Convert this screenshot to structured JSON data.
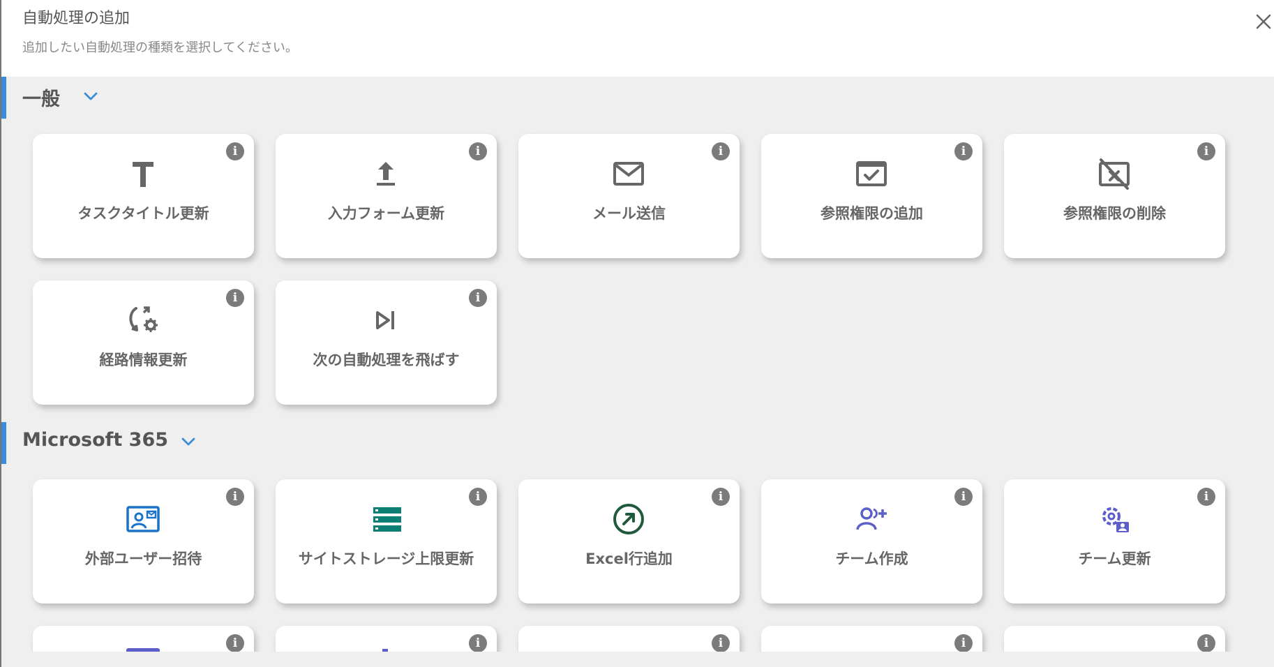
{
  "dialog": {
    "title": "自動処理の追加",
    "subtitle": "追加したい自動処理の種類を選択してください。",
    "close_icon": "close-icon"
  },
  "sections": [
    {
      "title": "一般",
      "chevron_icon": "chevron-down-icon",
      "cards": [
        {
          "label": "タスクタイトル更新",
          "icon": "text-t-icon"
        },
        {
          "label": "入力フォーム更新",
          "icon": "upload-arrow-icon"
        },
        {
          "label": "メール送信",
          "icon": "mail-icon"
        },
        {
          "label": "参照権限の追加",
          "icon": "window-check-icon"
        },
        {
          "label": "参照権限の削除",
          "icon": "window-remove-icon"
        },
        {
          "label": "経路情報更新",
          "icon": "route-settings-icon"
        },
        {
          "label": "次の自動処理を飛ばす",
          "icon": "skip-next-icon"
        }
      ]
    },
    {
      "title": "Microsoft 365",
      "chevron_icon": "chevron-down-icon",
      "cards": [
        {
          "label": "外部ユーザー招待",
          "icon": "contact-card-icon"
        },
        {
          "label": "サイトストレージ上限更新",
          "icon": "storage-list-icon"
        },
        {
          "label": "Excel行追加",
          "icon": "excel-arrow-icon"
        },
        {
          "label": "チーム作成",
          "icon": "team-add-icon"
        },
        {
          "label": "チーム更新",
          "icon": "team-settings-icon"
        }
      ]
    }
  ],
  "info_label": "i",
  "colors": {
    "accent_bar": "#3b8ed6",
    "chevron": "#3b8ed6",
    "icon_gray": "#666666",
    "icon_blue": "#1a73c9",
    "icon_teal": "#0d7f74",
    "icon_green": "#1f5a3d",
    "icon_purple": "#5b5fc7",
    "info_badge": "#7b7b7b"
  }
}
